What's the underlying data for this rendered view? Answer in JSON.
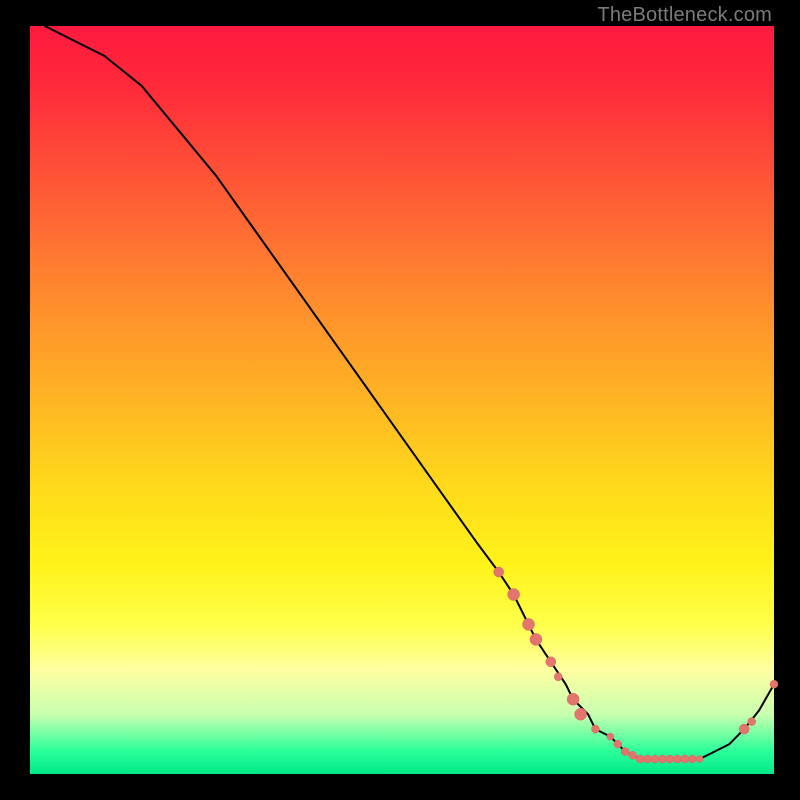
{
  "watermark": {
    "text": "TheBottleneck.com"
  },
  "colors": {
    "curve_stroke": "#000000",
    "marker_fill": "#e2766e",
    "marker_stroke": "#d8655d"
  },
  "chart_data": {
    "type": "line",
    "title": "",
    "xlabel": "",
    "ylabel": "",
    "xlim": [
      0,
      100
    ],
    "ylim": [
      0,
      100
    ],
    "grid": false,
    "note": "Axes/ticks not shown; x/y are normalized 0–100 from visual gridlines.",
    "series": [
      {
        "name": "bottleneck-curve",
        "x": [
          2,
          6,
          10,
          15,
          20,
          25,
          30,
          35,
          40,
          45,
          50,
          55,
          60,
          63,
          65,
          67,
          68,
          70,
          72,
          73,
          75,
          76,
          78,
          79,
          80,
          81,
          82,
          83,
          84,
          85,
          86,
          87,
          88,
          89,
          90,
          92,
          94,
          96,
          98,
          100
        ],
        "y": [
          100,
          98,
          96,
          92,
          86,
          80,
          73,
          66,
          59,
          52,
          45,
          38,
          31,
          27,
          24,
          20,
          18,
          15,
          12,
          10,
          8,
          6,
          5,
          4,
          3,
          2.5,
          2,
          2,
          2,
          2,
          2,
          2,
          2,
          2,
          2,
          3,
          4,
          6,
          8.5,
          12
        ]
      }
    ],
    "markers": [
      {
        "x": 63,
        "y": 27,
        "r": 5
      },
      {
        "x": 65,
        "y": 24,
        "r": 6
      },
      {
        "x": 67,
        "y": 20,
        "r": 6
      },
      {
        "x": 68,
        "y": 18,
        "r": 6
      },
      {
        "x": 70,
        "y": 15,
        "r": 5
      },
      {
        "x": 71,
        "y": 13,
        "r": 4
      },
      {
        "x": 73,
        "y": 10,
        "r": 6
      },
      {
        "x": 74,
        "y": 8,
        "r": 6
      },
      {
        "x": 76,
        "y": 6,
        "r": 4
      },
      {
        "x": 78,
        "y": 5,
        "r": 3.5
      },
      {
        "x": 79,
        "y": 4,
        "r": 4
      },
      {
        "x": 80,
        "y": 3,
        "r": 4
      },
      {
        "x": 81,
        "y": 2.5,
        "r": 4
      },
      {
        "x": 82,
        "y": 2,
        "r": 4
      },
      {
        "x": 83,
        "y": 2,
        "r": 4
      },
      {
        "x": 84,
        "y": 2,
        "r": 4
      },
      {
        "x": 85,
        "y": 2,
        "r": 4
      },
      {
        "x": 86,
        "y": 2,
        "r": 4
      },
      {
        "x": 87,
        "y": 2,
        "r": 4
      },
      {
        "x": 88,
        "y": 2,
        "r": 4
      },
      {
        "x": 89,
        "y": 2,
        "r": 4
      },
      {
        "x": 90,
        "y": 2,
        "r": 3.5
      },
      {
        "x": 96,
        "y": 6,
        "r": 5
      },
      {
        "x": 97,
        "y": 7,
        "r": 4
      },
      {
        "x": 100,
        "y": 12,
        "r": 4
      }
    ]
  }
}
